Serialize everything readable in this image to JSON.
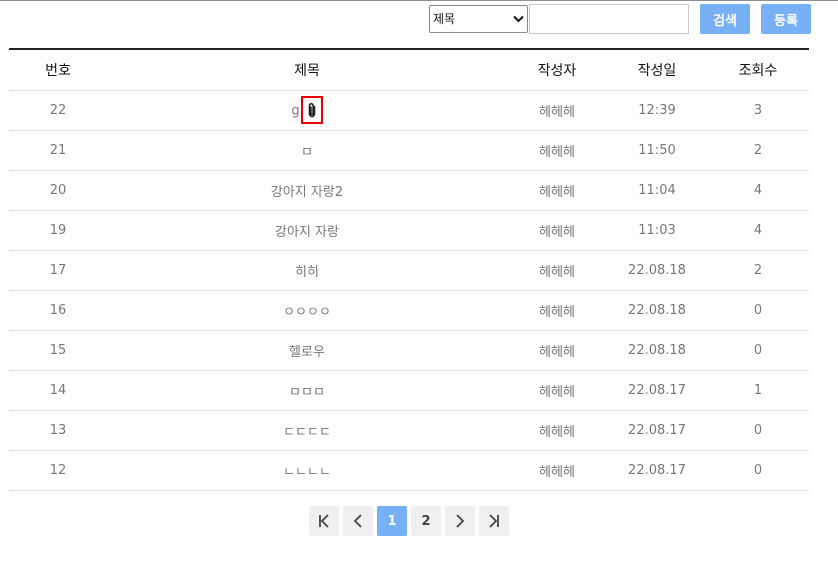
{
  "search": {
    "field_selected": "제목",
    "field_options": [
      "제목"
    ],
    "query_value": "",
    "search_label": "검색",
    "register_label": "등록"
  },
  "table": {
    "columns": [
      "번호",
      "제목",
      "작성자",
      "작성일",
      "조회수"
    ],
    "rows": [
      {
        "no": "22",
        "title": "g",
        "author": "헤헤헤",
        "date": "12:39",
        "views": "3",
        "attachment": true
      },
      {
        "no": "21",
        "title": "ㅁ",
        "author": "헤헤헤",
        "date": "11:50",
        "views": "2"
      },
      {
        "no": "20",
        "title": "강아지 자랑2",
        "author": "헤헤헤",
        "date": "11:04",
        "views": "4"
      },
      {
        "no": "19",
        "title": "강아지 자랑",
        "author": "헤헤헤",
        "date": "11:03",
        "views": "4"
      },
      {
        "no": "17",
        "title": "히히",
        "author": "헤헤헤",
        "date": "22.08.18",
        "views": "2"
      },
      {
        "no": "16",
        "title": "ㅇㅇㅇㅇ",
        "author": "헤헤헤",
        "date": "22.08.18",
        "views": "0"
      },
      {
        "no": "15",
        "title": "헬로우",
        "author": "헤헤헤",
        "date": "22.08.18",
        "views": "0"
      },
      {
        "no": "14",
        "title": "ㅁㅁㅁ",
        "author": "헤헤헤",
        "date": "22.08.17",
        "views": "1"
      },
      {
        "no": "13",
        "title": "ㄷㄷㄷㄷ",
        "author": "헤헤헤",
        "date": "22.08.17",
        "views": "0"
      },
      {
        "no": "12",
        "title": "ㄴㄴㄴㄴ",
        "author": "헤헤헤",
        "date": "22.08.17",
        "views": "0"
      }
    ]
  },
  "pagination": {
    "pages": [
      "1",
      "2"
    ],
    "current": "1",
    "icons": [
      "first-page-icon",
      "prev-page-icon",
      "next-page-icon",
      "last-page-icon"
    ]
  },
  "colors": {
    "accent": "#77b0f4",
    "highlight_box": "#e60000"
  }
}
